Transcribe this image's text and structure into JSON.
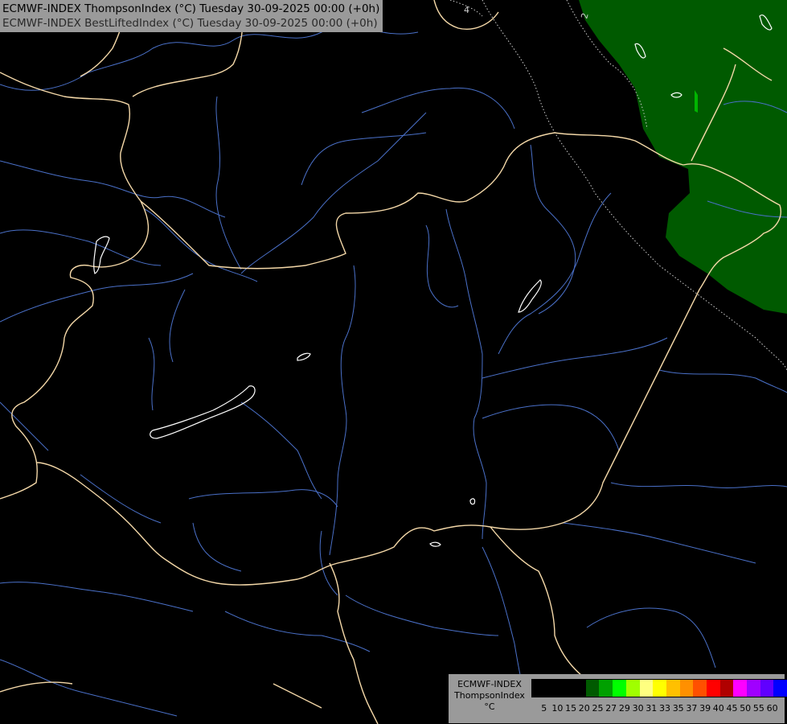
{
  "title": {
    "line1": "ECMWF-INDEX ThompsonIndex (°C) Tuesday 30-09-2025 00:00 (+0h)",
    "line2": "ECMWF-INDEX BestLiftedIndex (°C) Tuesday 30-09-2025 00:00 (+0h)"
  },
  "contour_labels": [
    "4",
    "2"
  ],
  "legend": {
    "line1": "ECMWF-INDEX",
    "line2": "ThompsonIndex",
    "line3": "°C",
    "levels": [
      "5",
      "10",
      "15",
      "20",
      "25",
      "27",
      "29",
      "30",
      "31",
      "33",
      "35",
      "37",
      "39",
      "40",
      "45",
      "50",
      "55",
      "60"
    ],
    "colors": [
      "#000000",
      "#000000",
      "#000000",
      "#000000",
      "#005a00",
      "#00a000",
      "#00ff00",
      "#a0ff00",
      "#ffff80",
      "#ffff00",
      "#ffc000",
      "#ff9000",
      "#ff5000",
      "#ff0000",
      "#b00000",
      "#ff00ff",
      "#a000ff",
      "#6000ff",
      "#0000ff"
    ]
  },
  "colors": {
    "background": "#000000",
    "ti_25_area": "#005a00",
    "ti_29_area": "#00b400",
    "borders": "#f4d8a8",
    "rivers": "#4a70c8",
    "lakes": "#ffffff",
    "bli_contours": "#d0d0d0"
  }
}
